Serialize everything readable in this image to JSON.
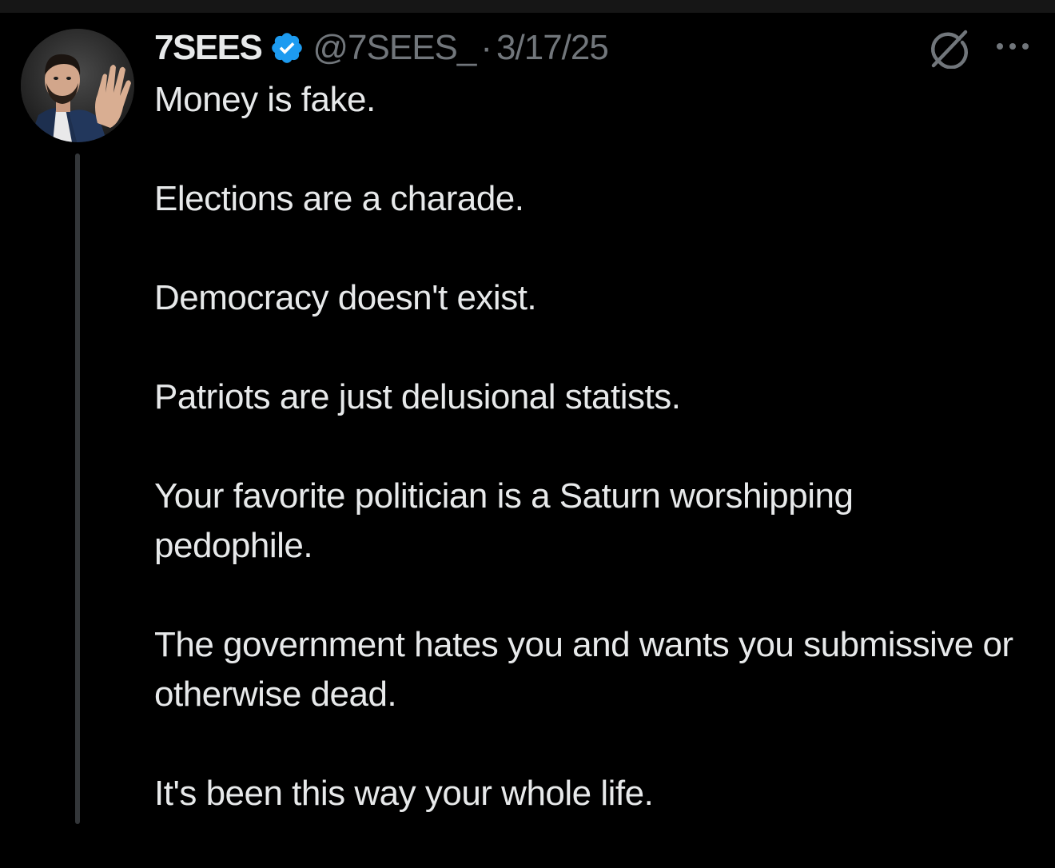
{
  "tweet": {
    "display_name": "7SEES",
    "handle": "@7SEES_",
    "separator": "·",
    "date": "3/17/25",
    "verified": true,
    "paragraphs": [
      "Money is fake.",
      "Elections are a charade.",
      "Democracy doesn't exist.",
      "Patriots are just delusional statists.",
      "Your favorite politician is a Saturn worshipping pedophile.",
      "The government hates you and wants you submissive or otherwise dead.",
      "It's been this way your whole life."
    ]
  },
  "icons": {
    "verified": "verified-badge-icon",
    "grok": "grok-icon",
    "more": "more-icon"
  },
  "colors": {
    "background": "#000000",
    "text": "#e7e9ea",
    "muted": "#71767b",
    "verified": "#1d9bf0",
    "thread_line": "#333639"
  }
}
